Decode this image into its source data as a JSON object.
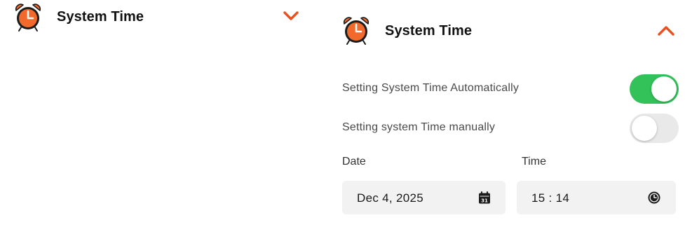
{
  "collapsed_panel": {
    "title": "System Time",
    "icon": "alarm-clock-icon",
    "toggle_icon": "chevron-down-icon",
    "accent_color": "#e8501e"
  },
  "expanded_panel": {
    "title": "System Time",
    "icon": "alarm-clock-icon",
    "toggle_icon": "chevron-up-icon",
    "auto_label": "Setting System Time Automatically",
    "auto_enabled": true,
    "manual_label": "Setting system Time manually",
    "manual_enabled": false,
    "on_color": "#33c159",
    "date_label": "Date",
    "date_value": "Dec 4, 2025",
    "date_icon": "calendar-icon",
    "time_label": "Time",
    "time_value": "15 : 14",
    "time_icon": "clock-icon"
  }
}
